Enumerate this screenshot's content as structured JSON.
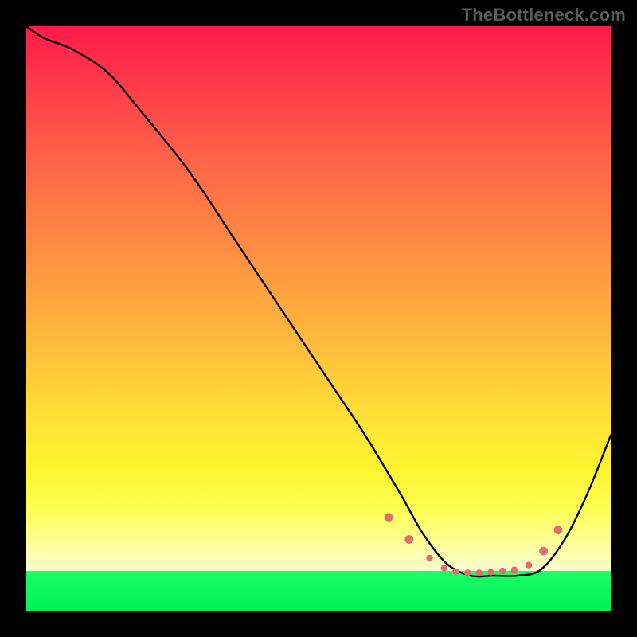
{
  "watermark": "TheBottleneck.com",
  "chart_data": {
    "type": "line",
    "title": "",
    "xlabel": "",
    "ylabel": "",
    "xlim": [
      0,
      100
    ],
    "ylim": [
      0,
      100
    ],
    "grid": false,
    "series": [
      {
        "name": "curve",
        "color": "#000000",
        "x": [
          0,
          3,
          8,
          14,
          20,
          28,
          36,
          44,
          52,
          58,
          64,
          68,
          72,
          76,
          80,
          84,
          88,
          92,
          96,
          100
        ],
        "y": [
          100,
          98,
          96,
          92,
          85,
          75,
          63,
          51,
          39,
          30,
          20,
          13,
          8,
          6,
          6,
          6,
          7,
          12,
          20,
          30
        ]
      }
    ],
    "annotations": {
      "valley_dots": {
        "color": "#e76a6f",
        "radius_small": 4.2,
        "radius_large": 5.4,
        "points_x": [
          62,
          65.5,
          69,
          71.5,
          73.5,
          75.5,
          77.5,
          79.5,
          81.5,
          83.5,
          86,
          88.5,
          91
        ],
        "points_y": [
          16,
          12.2,
          9,
          7.3,
          6.7,
          6.5,
          6.5,
          6.6,
          6.8,
          7.0,
          7.8,
          10.2,
          13.8
        ],
        "large_indices": [
          0,
          1,
          11,
          12
        ]
      }
    }
  }
}
